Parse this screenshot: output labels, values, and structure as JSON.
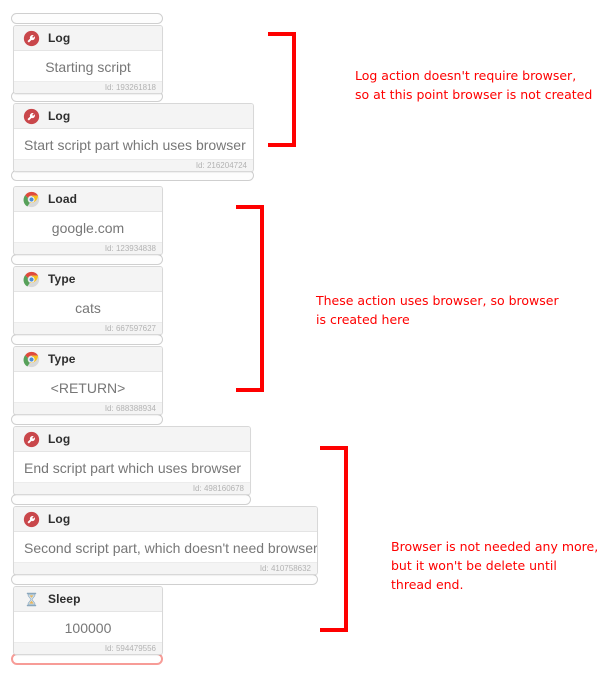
{
  "workflow": {
    "cards": [
      {
        "action": "Log",
        "icon": "log-wrench-icon",
        "value": "Starting script",
        "id_label": "Id: 193261818"
      },
      {
        "action": "Log",
        "icon": "log-wrench-icon",
        "value": "Start script part which uses browser",
        "id_label": "Id: 216204724"
      },
      {
        "action": "Load",
        "icon": "chrome-icon",
        "value": "google.com",
        "id_label": "Id: 123934838"
      },
      {
        "action": "Type",
        "icon": "chrome-icon",
        "value": "cats",
        "id_label": "Id: 667597627"
      },
      {
        "action": "Type",
        "icon": "chrome-icon",
        "value": "<RETURN>",
        "id_label": "Id: 688388934"
      },
      {
        "action": "Log",
        "icon": "log-wrench-icon",
        "value": "End script part which uses browser",
        "id_label": "Id: 498160678"
      },
      {
        "action": "Log",
        "icon": "log-wrench-icon",
        "value": "Second script part, which doesn't need browser",
        "id_label": "Id: 410758632"
      },
      {
        "action": "Sleep",
        "icon": "hourglass-icon",
        "value": "100000",
        "id_label": "Id: 594479556"
      }
    ]
  },
  "annotations": [
    {
      "text": "Log action doesn't require browser,\nso at this point browser is not created"
    },
    {
      "text": "These action uses browser, so browser\nis created here"
    },
    {
      "text": "Browser is not needed any more,\nbut it won't be delete until\nthread end."
    }
  ],
  "colors": {
    "annotation_red": "#fe0000",
    "active_dropzone": "#f79c97",
    "card_border": "#d8d8d8",
    "card_header_bg": "#f4f4f4"
  }
}
